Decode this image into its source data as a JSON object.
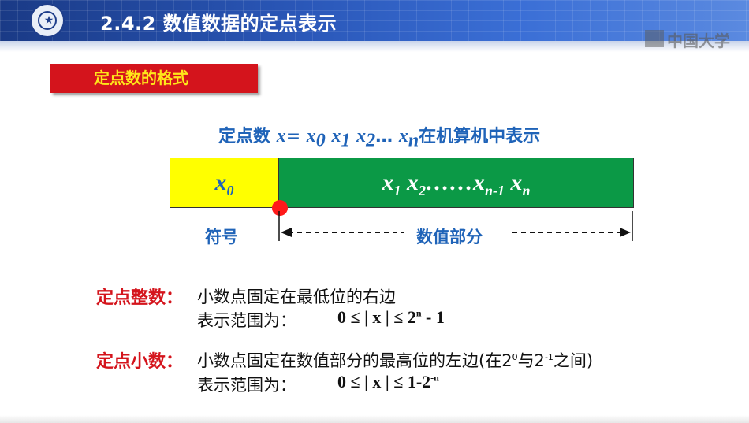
{
  "header": {
    "title": "2.4.2 数值数据的定点表示",
    "watermark": "中国大学"
  },
  "section_tag": "定点数的格式",
  "formula": {
    "prefix": "定点数",
    "var": "x",
    "eq": "=",
    "x": "x",
    "s0": "0",
    "s1": "1",
    "s2": "2",
    "dots": "…",
    "sn": "n",
    "suffix": "在机算机中表示"
  },
  "diagram": {
    "sign_var": "x",
    "sign_sub": "0",
    "value_x1": "x",
    "value_s1": "1",
    "value_x2": "x",
    "value_s2": "2",
    "value_dots": "……",
    "value_xn1": "x",
    "value_sn1": "n-1",
    "value_xn": "x",
    "value_sn": "n",
    "sign_label": "符号",
    "value_label": "数值部分"
  },
  "definitions": {
    "integer_head": "定点整数：",
    "integer_desc": "小数点固定在最低位的右边",
    "integer_range_label": "表示范围为：",
    "integer_range_a": "0 ≤ | ",
    "integer_range_x": "x",
    "integer_range_b": " | ≤ 2",
    "integer_range_exp": "n",
    "integer_range_c": " - 1",
    "fraction_head": "定点小数：",
    "fraction_desc_a": "小数点固定在数值部分的最高位的左边(在2",
    "fraction_desc_exp1": "0",
    "fraction_desc_b": "与2",
    "fraction_desc_exp2": "-1",
    "fraction_desc_c": "之间)",
    "fraction_range_label": "表示范围为：",
    "fraction_range_a": "0 ≤ | ",
    "fraction_range_x": "x",
    "fraction_range_b": " | ≤ 1-2",
    "fraction_range_exp": "-n"
  },
  "colors": {
    "header_blue": "#2a57b8",
    "tag_red": "#d4141c",
    "tag_text": "#ffe71a",
    "formula_blue": "#1f63b8",
    "sign_yellow": "#ffff00",
    "value_green": "#0b9946",
    "dot_red": "#ff1a1a"
  }
}
